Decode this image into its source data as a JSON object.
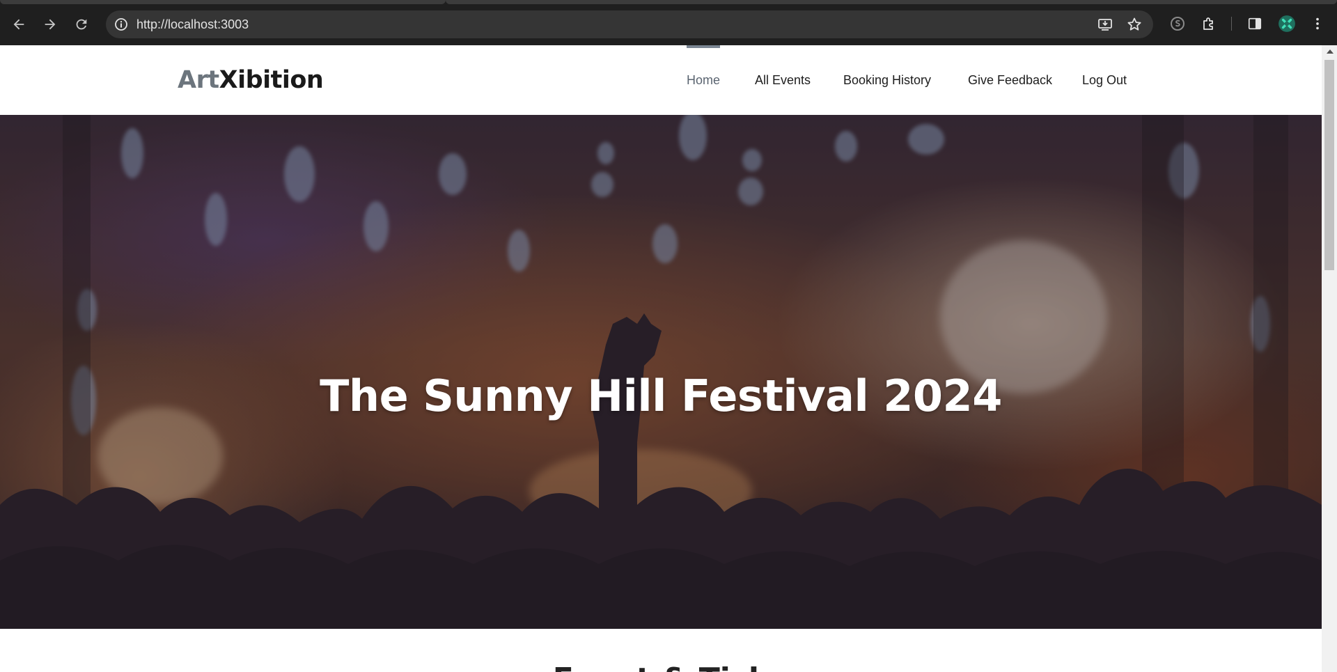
{
  "browser": {
    "url": "http://localhost:3003",
    "icons": {
      "back": "arrow-left-icon",
      "forward": "arrow-right-icon",
      "reload": "reload-icon",
      "site_info": "info-icon",
      "install": "install-app-icon",
      "bookmark": "star-icon",
      "extension_a": "extension-s-icon",
      "extensions": "puzzle-icon",
      "side_panel": "side-panel-icon",
      "profile": "profile-icon",
      "menu": "kebab-menu-icon"
    }
  },
  "site": {
    "logo": {
      "part1": "Art",
      "part2": "Xibition"
    },
    "nav": [
      {
        "label": "Home",
        "active": true
      },
      {
        "label": "All Events",
        "active": false
      },
      {
        "label": "Booking History",
        "active": false
      },
      {
        "label": "Give Feedback",
        "active": false
      },
      {
        "label": "Log Out",
        "active": false
      }
    ],
    "hero": {
      "title": "The Sunny Hill Festival 2024"
    },
    "next_section_heading_partial": "Event & Tick"
  },
  "colors": {
    "chrome_bg": "#1f1f1f",
    "omnibox_bg": "#353535",
    "logo_gray": "#6c757d",
    "logo_dark": "#1a1a1a",
    "nav_active": "#5a6470",
    "hero_text": "#ffffff"
  }
}
